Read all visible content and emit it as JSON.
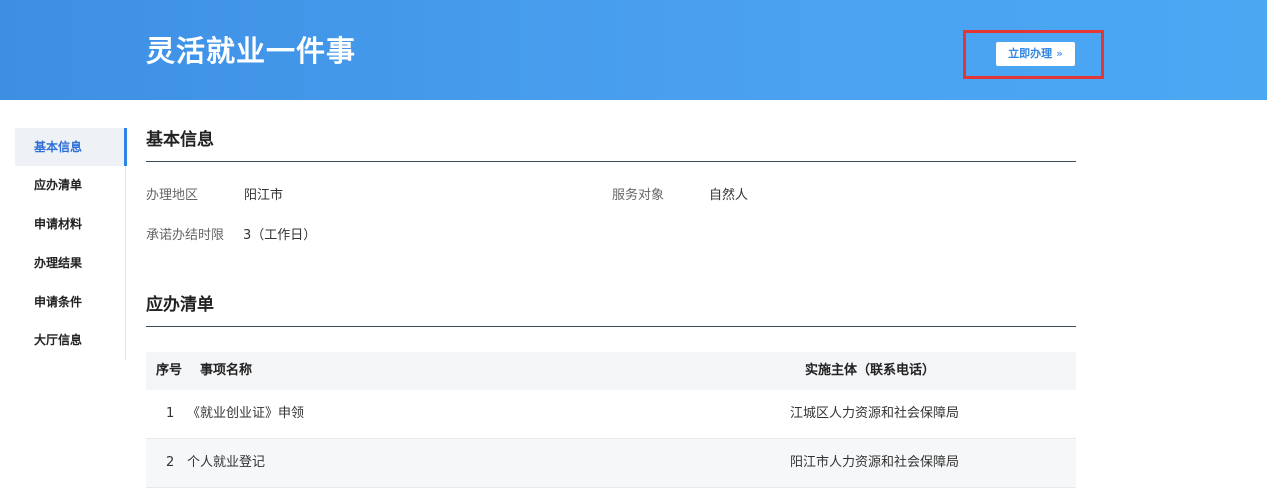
{
  "header": {
    "title": "灵活就业一件事",
    "apply_button_label": "立即办理",
    "apply_button_icon": "double-chevron-right-icon",
    "apply_button_chevron": "»"
  },
  "sidebar": {
    "items": [
      {
        "label": "基本信息",
        "active": true
      },
      {
        "label": "应办清单",
        "active": false
      },
      {
        "label": "申请材料",
        "active": false
      },
      {
        "label": "办理结果",
        "active": false
      },
      {
        "label": "申请条件",
        "active": false
      },
      {
        "label": "大厅信息",
        "active": false
      }
    ]
  },
  "basic_info": {
    "title": "基本信息",
    "region_label": "办理地区",
    "region_value": "阳江市",
    "target_label": "服务对象",
    "target_value": "自然人",
    "time_limit_label": "承诺办结时限",
    "time_limit_value": "3（工作日）"
  },
  "task_list": {
    "title": "应办清单",
    "columns": [
      "序号",
      "事项名称",
      "实施主体（联系电话）"
    ],
    "rows": [
      {
        "index": "1",
        "name": "《就业创业证》申领",
        "agency": "江城区人力资源和社会保障局"
      },
      {
        "index": "2",
        "name": "个人就业登记",
        "agency": "阳江市人力资源和社会保障局"
      }
    ]
  },
  "colors": {
    "header_blue": "#4aa0ef",
    "highlight_red": "#e53535",
    "active_blue": "#2f86e4"
  }
}
